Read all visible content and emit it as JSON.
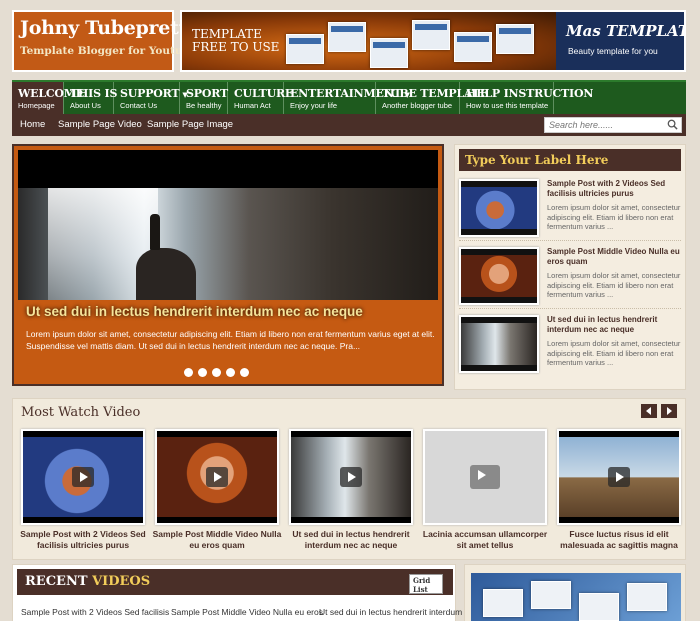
{
  "header": {
    "title": "Johny Tubeprett",
    "tagline": "Template Blogger for Youtube",
    "banner_text": "TEMPLATE FREE TO USE",
    "mas_brand": "Mas TEMPLATE",
    "mas_tagline": "Beauty template for you"
  },
  "nav": [
    {
      "label": "WELCOME",
      "desc": "Homepage",
      "active": true
    },
    {
      "label": "THIS IS",
      "desc": "About Us"
    },
    {
      "label": "SUPPORT",
      "desc": "Contact Us",
      "caret": true
    },
    {
      "label": "SPORT",
      "desc": "Be healthy"
    },
    {
      "label": "CULTURE",
      "desc": "Human Act"
    },
    {
      "label": "ENTERTAINMENT",
      "desc": "Enjoy your life",
      "caret": true
    },
    {
      "label": "TUBE TEMPLATE",
      "desc": "Another blogger tube"
    },
    {
      "label": "HELP INSTRUCTION",
      "desc": "How to use this template"
    }
  ],
  "subnav": {
    "links": [
      "Home",
      "Sample Page Video",
      "Sample Page Image"
    ],
    "search_placeholder": "Search here......"
  },
  "slider": {
    "caption": "Ut sed dui in lectus hendrerit interdum nec ac neque",
    "description": "Lorem ipsum dolor sit amet, consectetur adipiscing elit. Etiam id libero non erat fermentum varius eget at elit. Suspendisse vel mattis diam. Ut sed dui in lectus hendrerit interdum nec ac neque. Pra...",
    "dot_count": 5
  },
  "label_box": {
    "title": "Type Your Label Here",
    "posts": [
      {
        "title": "Sample Post with 2 Videos Sed facilisis ultricies purus",
        "excerpt": "Lorem ipsum dolor sit amet, consectetur adipiscing elit. Etiam id libero non erat fermentum varius ..."
      },
      {
        "title": "Sample Post Middle Video Nulla eu eros quam",
        "excerpt": "Lorem ipsum dolor sit amet, consectetur adipiscing elit. Etiam id libero non erat fermentum varius ..."
      },
      {
        "title": "Ut sed dui in lectus hendrerit interdum nec ac neque",
        "excerpt": "Lorem ipsum dolor sit amet, consectetur adipiscing elit. Etiam id libero non erat fermentum varius ..."
      }
    ]
  },
  "most_watch": {
    "title": "Most Watch Video",
    "videos": [
      {
        "caption": "Sample Post with 2 Videos Sed facilisis ultricies purus"
      },
      {
        "caption": "Sample Post Middle Video Nulla eu eros quam"
      },
      {
        "caption": "Ut sed dui in lectus hendrerit interdum nec ac neque"
      },
      {
        "caption": "Lacinia accumsan ullamcorper sit amet tellus"
      },
      {
        "caption": "Fusce luctus risus id elit malesuada ac sagittis magna"
      }
    ]
  },
  "recent": {
    "title_a": "RECENT",
    "title_b": "VIDEOS",
    "view_grid": "Grid",
    "view_list": "List",
    "items": [
      "Sample Post with 2 Videos Sed facilisis",
      "Sample Post Middle Video Nulla eu eros",
      "Ut sed dui in lectus hendrerit interdum"
    ]
  },
  "colors": {
    "brown": "#4a2f28",
    "orange": "#c55a12",
    "green": "#1e5a1e",
    "gold": "#f2cd5a"
  }
}
